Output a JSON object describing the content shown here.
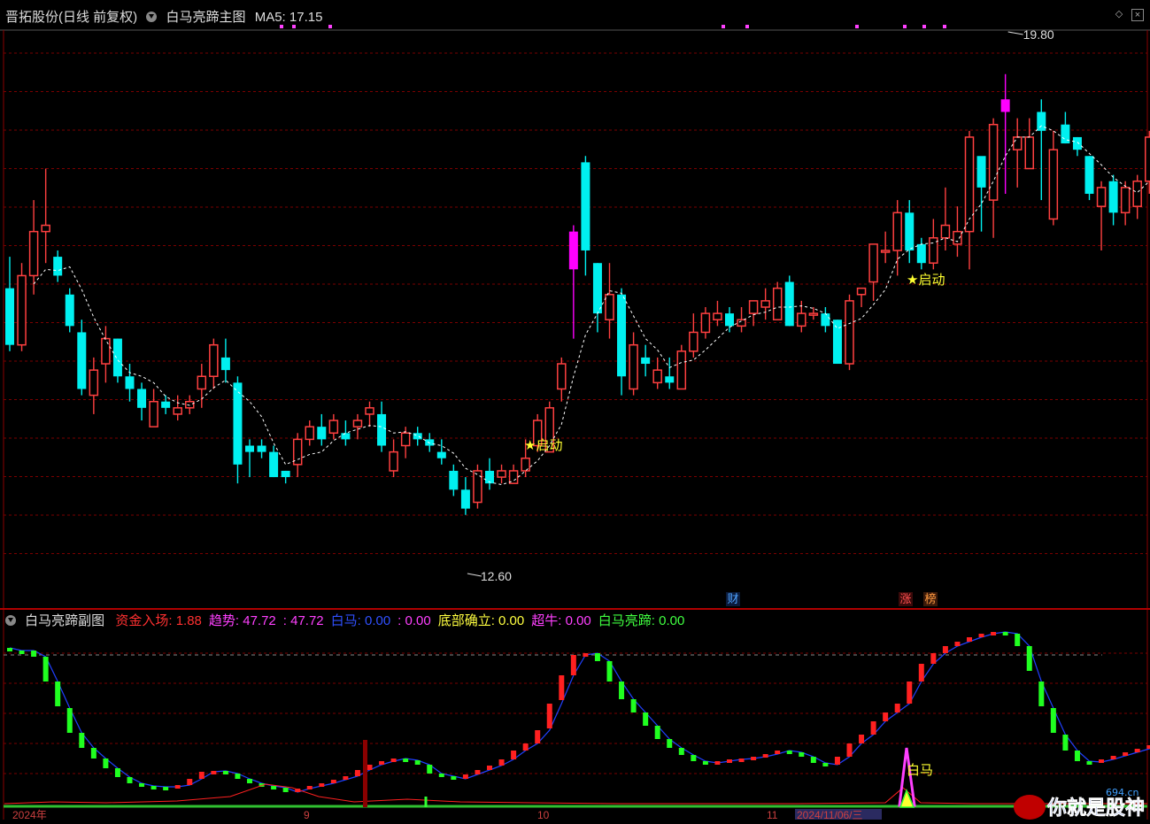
{
  "main_panel": {
    "stock": "晋拓股份(日线 前复权)",
    "indicator": "白马亮蹄主图",
    "ma_label": "MA5: 17.15",
    "high_label": "19.80",
    "low_label": "12.60",
    "signal_label": "★启动",
    "badge_cai": "财",
    "badge_zhang": "涨",
    "badge_bang": "榜"
  },
  "sub_panel": {
    "title": "白马亮蹄副图",
    "fields": [
      {
        "label": "资金入场: 1.88",
        "color": "#ff3030"
      },
      {
        "label": "趋势: 47.72",
        "color": "#ff40ff"
      },
      {
        "label": ": 47.72",
        "color": "#ff40ff"
      },
      {
        "label": "白马: 0.00",
        "color": "#3050ff"
      },
      {
        "label": ": 0.00",
        "color": "#ff40ff"
      },
      {
        "label": "底部确立: 0.00",
        "color": "#ffff40"
      },
      {
        "label": "超牛: 0.00",
        "color": "#ff40ff"
      },
      {
        "label": "白马亮蹄: 0.00",
        "color": "#40ff40"
      }
    ],
    "baima_label": "白马"
  },
  "axis_bottom": {
    "labels": [
      "2024年",
      "9",
      "10",
      "11",
      "2024/11/06/三"
    ]
  },
  "watermark": {
    "brand": "你就是股神",
    "site": "694.cn"
  },
  "colors": {
    "up": "#ff4040",
    "down": "#00f0f0",
    "special": "#ff00ff",
    "grid": "#7a0000"
  },
  "chart_data": {
    "type": "candlestick",
    "price_range": [
      11.5,
      20.3
    ],
    "candles": [
      [
        16.2,
        15.3,
        16.7,
        15.2
      ],
      [
        15.3,
        16.4,
        16.6,
        15.2
      ],
      [
        16.4,
        17.1,
        17.6,
        16.1
      ],
      [
        17.1,
        17.2,
        18.1,
        16.6
      ],
      [
        16.7,
        16.4,
        16.8,
        16.3
      ],
      [
        16.1,
        15.6,
        16.2,
        15.5
      ],
      [
        15.5,
        14.6,
        15.7,
        14.5
      ],
      [
        14.5,
        14.9,
        15.1,
        14.2
      ],
      [
        15.0,
        15.4,
        15.6,
        14.7
      ],
      [
        15.4,
        14.8,
        15.4,
        14.7
      ],
      [
        14.8,
        14.6,
        15.0,
        14.4
      ],
      [
        14.6,
        14.3,
        14.7,
        14.1
      ],
      [
        14.0,
        14.4,
        14.6,
        14.0
      ],
      [
        14.4,
        14.3,
        14.5,
        14.2
      ],
      [
        14.2,
        14.3,
        14.5,
        14.1
      ],
      [
        14.3,
        14.4,
        14.5,
        14.2
      ],
      [
        14.6,
        14.8,
        15.0,
        14.3
      ],
      [
        14.8,
        15.3,
        15.4,
        14.6
      ],
      [
        15.1,
        14.9,
        15.4,
        14.7
      ],
      [
        14.7,
        13.4,
        14.8,
        13.1
      ],
      [
        13.7,
        13.6,
        13.8,
        13.2
      ],
      [
        13.7,
        13.6,
        13.8,
        13.5
      ],
      [
        13.6,
        13.2,
        13.7,
        13.2
      ],
      [
        13.3,
        13.2,
        13.3,
        13.1
      ],
      [
        13.4,
        13.8,
        13.9,
        13.2
      ],
      [
        13.8,
        14.0,
        14.1,
        13.7
      ],
      [
        14.0,
        13.8,
        14.2,
        13.7
      ],
      [
        13.9,
        14.1,
        14.2,
        13.8
      ],
      [
        13.9,
        13.8,
        14.1,
        13.7
      ],
      [
        14.0,
        14.1,
        14.2,
        13.8
      ],
      [
        14.2,
        14.3,
        14.4,
        14.0
      ],
      [
        14.2,
        13.7,
        14.4,
        13.6
      ],
      [
        13.3,
        13.6,
        13.8,
        13.2
      ],
      [
        13.7,
        13.9,
        14.0,
        13.5
      ],
      [
        13.9,
        13.8,
        14.0,
        13.7
      ],
      [
        13.8,
        13.7,
        13.9,
        13.6
      ],
      [
        13.6,
        13.5,
        13.8,
        13.4
      ],
      [
        13.3,
        13.0,
        13.4,
        12.9
      ],
      [
        13.0,
        12.7,
        13.2,
        12.6
      ],
      [
        12.8,
        13.3,
        13.4,
        12.7
      ],
      [
        13.3,
        13.1,
        13.5,
        13.0
      ],
      [
        13.2,
        13.3,
        13.4,
        13.1
      ],
      [
        13.1,
        13.3,
        13.4,
        13.1
      ],
      [
        13.3,
        13.5,
        13.8,
        13.2
      ],
      [
        13.7,
        14.1,
        14.2,
        13.6
      ],
      [
        13.6,
        14.3,
        14.4,
        13.6
      ],
      [
        14.6,
        15.0,
        15.1,
        14.4
      ],
      [
        16.5,
        17.1,
        17.2,
        15.4
      ],
      [
        18.2,
        16.8,
        18.3,
        16.4
      ],
      [
        16.6,
        15.8,
        16.6,
        15.5
      ],
      [
        15.7,
        16.1,
        16.6,
        15.4
      ],
      [
        16.1,
        14.8,
        16.2,
        14.5
      ],
      [
        14.6,
        15.3,
        15.5,
        14.5
      ],
      [
        15.1,
        15.0,
        15.3,
        14.8
      ],
      [
        14.7,
        14.9,
        15.1,
        14.6
      ],
      [
        14.8,
        14.7,
        15.1,
        14.6
      ],
      [
        14.6,
        15.2,
        15.3,
        14.6
      ],
      [
        15.2,
        15.5,
        15.8,
        15.1
      ],
      [
        15.5,
        15.8,
        15.9,
        15.4
      ],
      [
        15.7,
        15.8,
        16.0,
        15.6
      ],
      [
        15.8,
        15.6,
        15.9,
        15.5
      ],
      [
        15.6,
        15.7,
        15.9,
        15.5
      ],
      [
        15.8,
        16.0,
        16.0,
        15.6
      ],
      [
        15.9,
        16.0,
        16.2,
        15.7
      ],
      [
        15.7,
        16.2,
        16.3,
        15.7
      ],
      [
        16.3,
        15.6,
        16.4,
        15.6
      ],
      [
        15.6,
        15.8,
        16.0,
        15.5
      ],
      [
        15.8,
        15.8,
        15.9,
        15.7
      ],
      [
        15.8,
        15.6,
        15.9,
        15.5
      ],
      [
        15.7,
        15.0,
        15.7,
        15.0
      ],
      [
        15.0,
        16.0,
        16.1,
        14.9
      ],
      [
        16.1,
        16.2,
        16.2,
        15.9
      ],
      [
        16.3,
        16.9,
        16.9,
        16.0
      ],
      [
        16.8,
        16.8,
        17.1,
        16.6
      ],
      [
        16.8,
        17.4,
        17.6,
        16.4
      ],
      [
        17.4,
        16.8,
        17.6,
        16.6
      ],
      [
        16.9,
        16.6,
        17.0,
        16.5
      ],
      [
        16.6,
        17.0,
        17.3,
        16.5
      ],
      [
        17.0,
        17.2,
        17.8,
        16.8
      ],
      [
        16.9,
        17.1,
        17.5,
        16.7
      ],
      [
        17.1,
        18.6,
        18.7,
        16.5
      ],
      [
        18.3,
        17.8,
        18.2,
        17.1
      ],
      [
        17.6,
        18.8,
        18.9,
        17.0
      ],
      [
        19.0,
        19.2,
        19.6,
        17.7
      ],
      [
        18.4,
        18.6,
        18.9,
        17.8
      ],
      [
        18.1,
        18.6,
        18.9,
        18.1
      ],
      [
        19.0,
        18.7,
        19.2,
        17.6
      ],
      [
        17.3,
        18.4,
        18.7,
        17.2
      ],
      [
        18.8,
        18.5,
        19.0,
        18.5
      ],
      [
        18.6,
        18.4,
        18.6,
        18.3
      ],
      [
        18.3,
        17.7,
        18.3,
        17.6
      ],
      [
        17.5,
        17.8,
        17.9,
        16.8
      ],
      [
        17.9,
        17.4,
        18.0,
        17.2
      ],
      [
        17.4,
        17.8,
        17.9,
        17.2
      ],
      [
        17.5,
        17.9,
        18.0,
        17.3
      ],
      [
        17.9,
        18.6,
        18.7,
        17.7
      ]
    ]
  }
}
